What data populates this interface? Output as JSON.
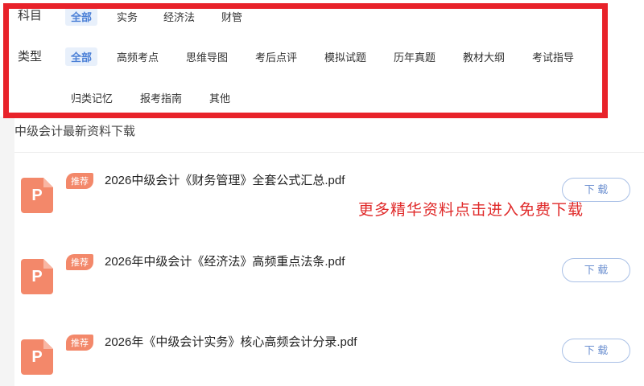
{
  "filters": {
    "subject_label": "科目",
    "subject_options": [
      "全部",
      "实务",
      "经济法",
      "财管"
    ],
    "type_label": "类型",
    "type_options_row1": [
      "全部",
      "高频考点",
      "思维导图",
      "考后点评",
      "模拟试题",
      "历年真题",
      "教材大纲",
      "考试指导"
    ],
    "type_options_row2": [
      "归类记忆",
      "报考指南",
      "其他"
    ]
  },
  "section_title": "中级会计最新资料下载",
  "promo_text": "更多精华资料点击进入免费下载",
  "items": [
    {
      "tag": "推荐",
      "icon_letter": "P",
      "title": "2026中级会计《财务管理》全套公式汇总.pdf",
      "button": "下 载"
    },
    {
      "tag": "推荐",
      "icon_letter": "P",
      "title": "2026年中级会计《经济法》高频重点法条.pdf",
      "button": "下 载"
    },
    {
      "tag": "推荐",
      "icon_letter": "P",
      "title": "2026年《中级会计实务》核心高频会计分录.pdf",
      "button": "下 载"
    }
  ],
  "colors": {
    "highlight_box": "#e8222a",
    "accent": "#4a7fd6",
    "tag": "#f3886a",
    "promo": "#e02a2a"
  }
}
